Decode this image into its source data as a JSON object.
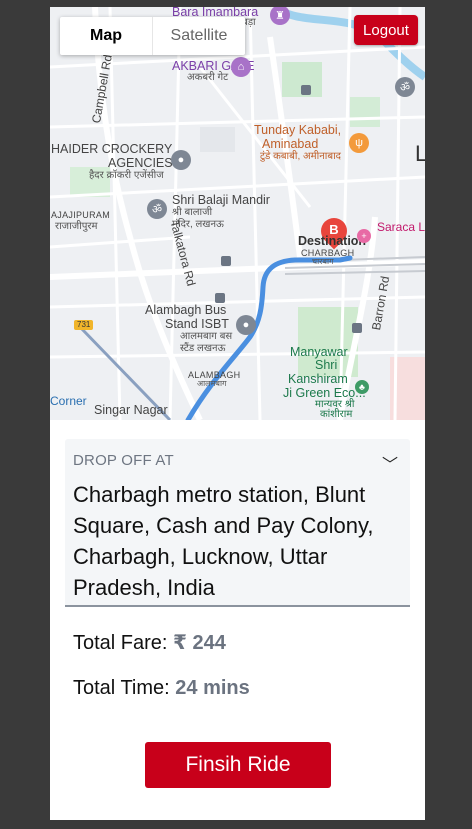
{
  "map": {
    "tabs": [
      {
        "label": "Map"
      },
      {
        "label": "Satellite"
      }
    ],
    "logout_label": "Logout",
    "labels": {
      "bara_imambara": "Bara Imambara",
      "bara_hindi": "बड़ा",
      "akbari_gate": "AKBARI GATE",
      "akbari_hindi": "अकबरी गेट",
      "campbell": "Campbell Rd",
      "tunday": "Tunday Kababi,",
      "aminabad": "Aminabad",
      "tunday_hindi": "टुंडे कबाबी, अमीनाबाद",
      "haider1": "HAIDER CROCKERY",
      "haider2": "AGENCIES",
      "haider_hindi": "हैदर क्रॉकरी एजेंसीज",
      "balaji": "Shri Balaji Mandir",
      "balaji_hindi1": "श्री बालाजी",
      "balaji_hindi2": "मंदिर, लखनऊ",
      "rajajipuram": "AJAJIPURAM",
      "rajajipuram_hindi": "राजाजीपुरम",
      "destination": "Destination",
      "charbagh": "CHARBAGH",
      "charbagh_hindi": "चारबाग",
      "saraca": "Saraca Lu",
      "talkatora": "Talkatora Rd",
      "alambagh_bus1": "Alambagh Bus",
      "alambagh_bus2": "Stand ISBT",
      "alambagh_bus_hindi1": "आलमबाग बस",
      "alambagh_bus_hindi2": "स्टैंड लखनऊ",
      "barron": "Barron Rd",
      "manyawar1": "Manyawar",
      "manyawar2": "Shri",
      "manyawar3": "Kanshiram",
      "manyawar4": "Ji Green Eco...",
      "manyawar_hindi1": "मान्यवर श्री",
      "manyawar_hindi2": "कांशीराम",
      "alambagh": "ALAMBAGH",
      "alambagh_hindi": "आलमबाग",
      "corner": "Corner",
      "singar": "Singar Nagar",
      "shield": "731",
      "edge_l": "L",
      "dest_letter": "B"
    }
  },
  "dropoff": {
    "caption": "DROP OFF AT",
    "address": "Charbagh metro station, Blunt Square, Cash and Pay Colony, Charbagh, Lucknow, Uttar Pradesh, India"
  },
  "fare": {
    "label": "Total Fare:",
    "value": "₹ 244"
  },
  "time": {
    "label": "Total Time:",
    "value": "24 mins"
  },
  "finish_label": "Finsih Ride",
  "colors": {
    "accent": "#c8001a",
    "route": "#4a8fe0"
  }
}
